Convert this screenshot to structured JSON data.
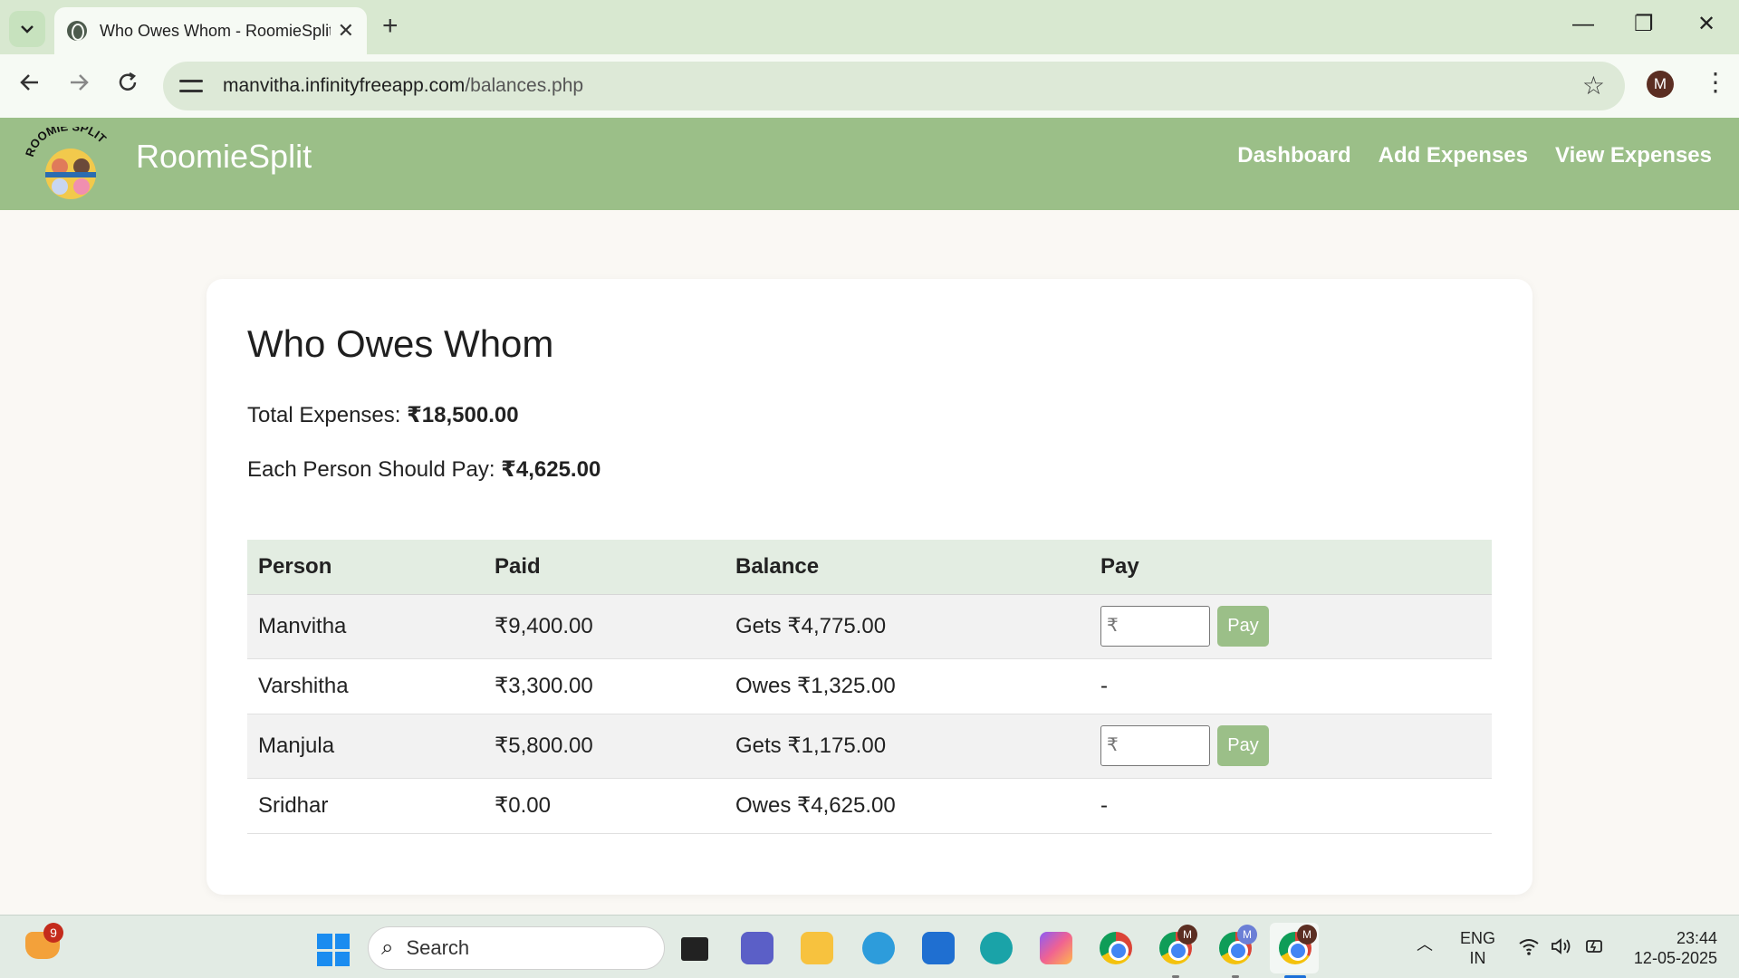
{
  "browser": {
    "tab_title": "Who Owes Whom - RoomieSplit",
    "tab_close": "✕",
    "new_tab": "+",
    "url_host": "manvitha.infinityfreeapp.com",
    "url_path": "/balances.php",
    "profile_initial": "M",
    "win_minimize": "—",
    "win_restore": "❐",
    "win_close": "✕"
  },
  "app": {
    "brand": "RoomieSplit",
    "logo_text": "ROOMIE SPLIT",
    "nav": [
      "Dashboard",
      "Add Expenses",
      "View Expenses"
    ]
  },
  "page": {
    "title": "Who Owes Whom",
    "total_label": "Total Expenses: ",
    "total_value": "₹18,500.00",
    "each_label": "Each Person Should Pay: ",
    "each_value": "₹4,625.00"
  },
  "table": {
    "headers": [
      "Person",
      "Paid",
      "Balance",
      "Pay"
    ],
    "rows": [
      {
        "person": "Manvitha",
        "paid": "₹9,400.00",
        "balance": "Gets ₹4,775.00",
        "pay": "form"
      },
      {
        "person": "Varshitha",
        "paid": "₹3,300.00",
        "balance": "Owes ₹1,325.00",
        "pay": "-"
      },
      {
        "person": "Manjula",
        "paid": "₹5,800.00",
        "balance": "Gets ₹1,175.00",
        "pay": "form"
      },
      {
        "person": "Sridhar",
        "paid": "₹0.00",
        "balance": "Owes ₹4,625.00",
        "pay": "-"
      }
    ],
    "pay_placeholder": "₹",
    "pay_button": "Pay"
  },
  "taskbar": {
    "notification_count": "9",
    "search_label": "Search",
    "lang_line1": "ENG",
    "lang_line2": "IN",
    "time": "23:44",
    "date": "12-05-2025",
    "chrome_badge": "M"
  },
  "colors": {
    "accent": "#9bbf88",
    "table_header": "#e3ede2"
  }
}
